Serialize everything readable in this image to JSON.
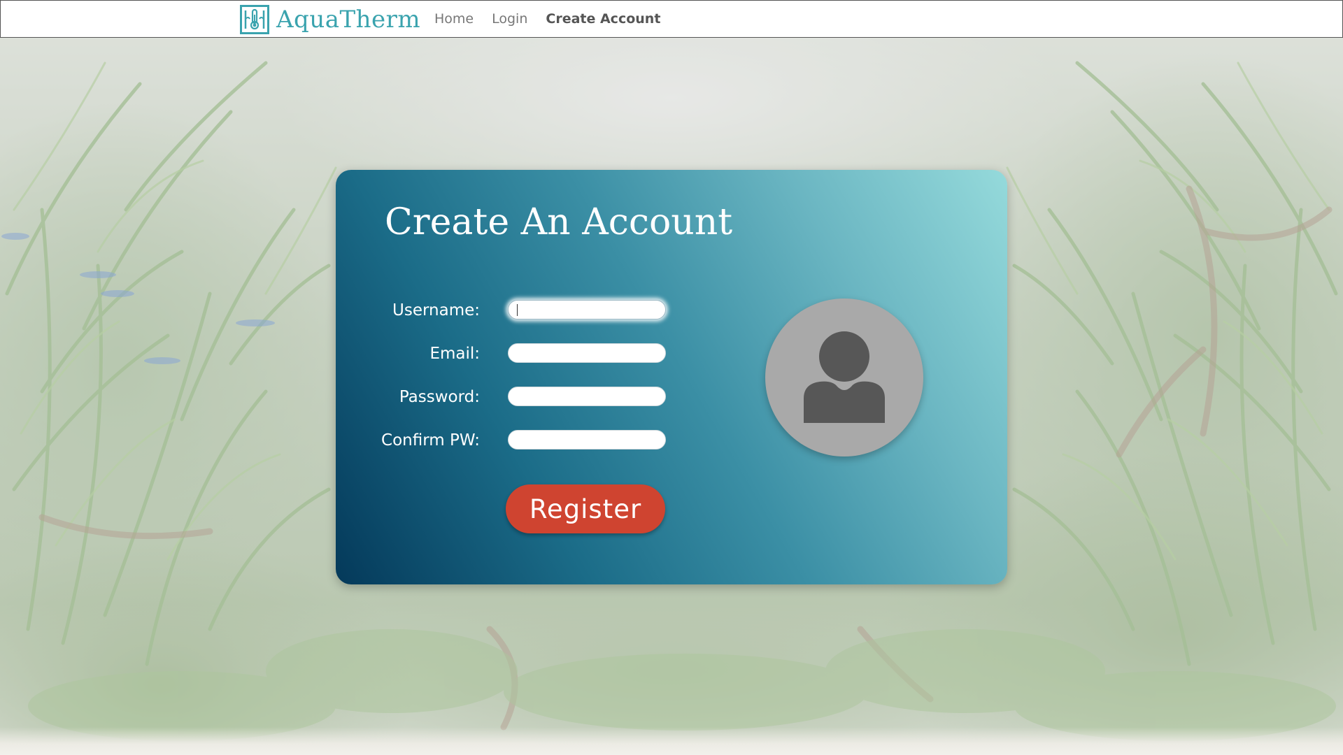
{
  "app": {
    "brand_name": "AquaTherm",
    "brand_color": "#3aa3ae"
  },
  "nav": {
    "links": [
      {
        "label": "Home",
        "active": false
      },
      {
        "label": "Login",
        "active": false
      },
      {
        "label": "Create Account",
        "active": true
      }
    ]
  },
  "card": {
    "title": "Create An Account",
    "gradient_start": "#04395a",
    "gradient_end": "#95dadb",
    "fields": [
      {
        "label": "Username:",
        "value": "",
        "focused": true
      },
      {
        "label": "Email:",
        "value": "",
        "focused": false
      },
      {
        "label": "Password:",
        "value": "",
        "focused": false
      },
      {
        "label": "Confirm PW:",
        "value": "",
        "focused": false
      }
    ],
    "register_label": "Register",
    "register_color": "#cf4430",
    "avatar_icon": "user-avatar-icon"
  }
}
